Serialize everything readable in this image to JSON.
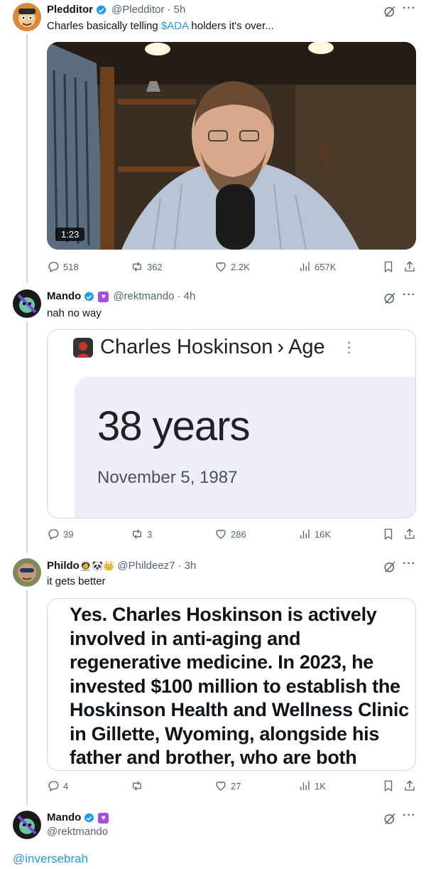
{
  "tweets": [
    {
      "name": "Pledditor",
      "handle": "@Pledditor",
      "time": "· 5h",
      "text_before": "Charles basically telling ",
      "cashtag": "$ADA",
      "text_after": " holders it's over...",
      "video_duration": "1:23",
      "stats": {
        "replies": "518",
        "reposts": "362",
        "likes": "2.2K",
        "views": "657K"
      }
    },
    {
      "name": "Mando",
      "handle": "@rektmando",
      "time": "· 4h",
      "text": "nah no way",
      "card": {
        "heading_name": "Charles Hoskinson",
        "heading_sep": "›",
        "heading_attr": "Age",
        "age": "38 years",
        "birthdate": "November 5, 1987"
      },
      "stats": {
        "replies": "39",
        "reposts": "3",
        "likes": "286",
        "views": "16K"
      }
    },
    {
      "name": "Phildo",
      "handle": "@Phildeez7",
      "time": "· 3h",
      "name_emojis": "🧑‍🚀🐼👑",
      "text": "it gets better",
      "quote_image_text": "Yes. Charles Hoskinson is actively involved in anti-aging and regenerative medicine. In 2023, he invested $100 million to establish the Hoskinson Health and Wellness Clinic in Gillette, Wyoming, alongside his father and brother, who are both physicians.",
      "stats": {
        "replies": "4",
        "reposts": "",
        "likes": "27",
        "views": "1K"
      }
    }
  ],
  "reply_user": {
    "name": "Mando",
    "handle": "@rektmando",
    "text": "@inversebrah"
  },
  "colors": {
    "verified": "#1d9bf0",
    "link": "#1d9bf0",
    "secondary_text": "#536471"
  }
}
